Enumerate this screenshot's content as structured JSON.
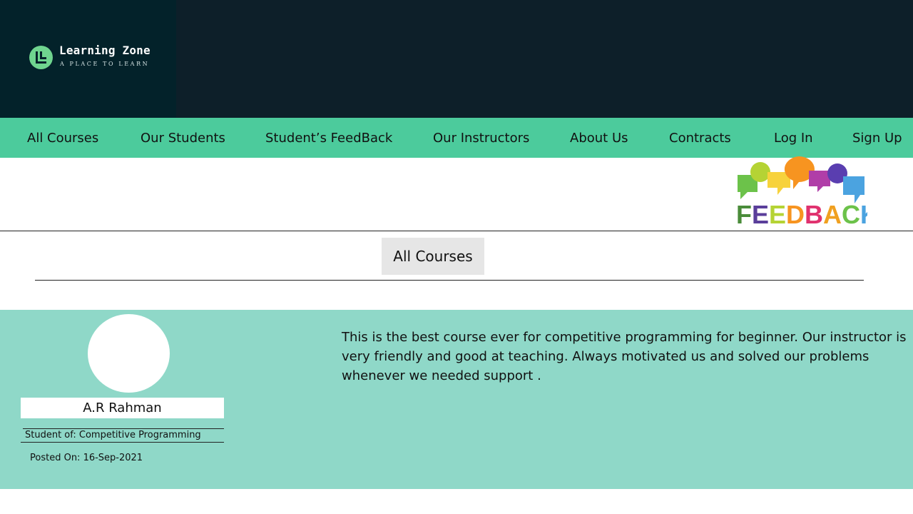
{
  "brand": {
    "name": "Learning Zone",
    "tagline": "A PLACE TO LEARN"
  },
  "nav": {
    "items": [
      "All Courses",
      "Our Students",
      "Student’s FeedBack",
      "Our Instructors",
      "About Us",
      "Contracts",
      "Log In",
      "Sign Up"
    ]
  },
  "hero": {
    "feedback_graphic_text": "FEEDBACK"
  },
  "filter": {
    "button_label": "All Courses"
  },
  "feedback_card": {
    "student_name": "A.R Rahman",
    "course_label": "Student of: Competitive Programming",
    "posted_label": "Posted On: 16-Sep-2021",
    "review_text": "This is the best course ever for competitive programming for beginner. Our instructor is very friendly and good at teaching. Always motivated us and solved our problems whenever we needed support ."
  },
  "colors": {
    "header_bg": "#0d1f29",
    "nav_bg": "#4ccb9c",
    "card_bg": "#8fd8c8",
    "logo_accent": "#6fd58f"
  }
}
